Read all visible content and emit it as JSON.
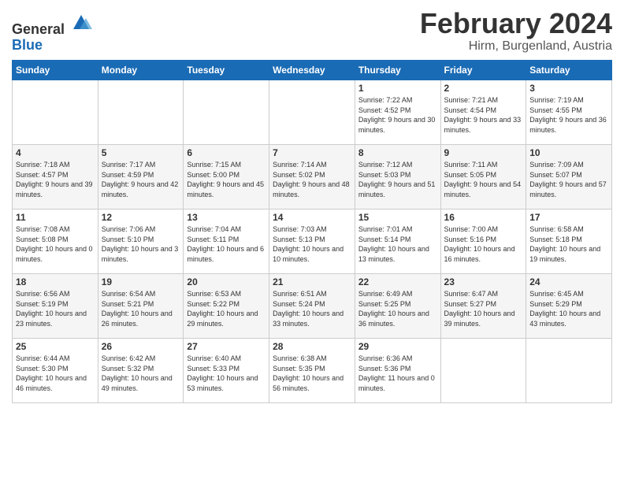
{
  "header": {
    "logo_line1": "General",
    "logo_line2": "Blue",
    "month_title": "February 2024",
    "location": "Hirm, Burgenland, Austria"
  },
  "weekdays": [
    "Sunday",
    "Monday",
    "Tuesday",
    "Wednesday",
    "Thursday",
    "Friday",
    "Saturday"
  ],
  "weeks": [
    [
      {
        "day": "",
        "sunrise": "",
        "sunset": "",
        "daylight": ""
      },
      {
        "day": "",
        "sunrise": "",
        "sunset": "",
        "daylight": ""
      },
      {
        "day": "",
        "sunrise": "",
        "sunset": "",
        "daylight": ""
      },
      {
        "day": "",
        "sunrise": "",
        "sunset": "",
        "daylight": ""
      },
      {
        "day": "1",
        "sunrise": "Sunrise: 7:22 AM",
        "sunset": "Sunset: 4:52 PM",
        "daylight": "Daylight: 9 hours and 30 minutes."
      },
      {
        "day": "2",
        "sunrise": "Sunrise: 7:21 AM",
        "sunset": "Sunset: 4:54 PM",
        "daylight": "Daylight: 9 hours and 33 minutes."
      },
      {
        "day": "3",
        "sunrise": "Sunrise: 7:19 AM",
        "sunset": "Sunset: 4:55 PM",
        "daylight": "Daylight: 9 hours and 36 minutes."
      }
    ],
    [
      {
        "day": "4",
        "sunrise": "Sunrise: 7:18 AM",
        "sunset": "Sunset: 4:57 PM",
        "daylight": "Daylight: 9 hours and 39 minutes."
      },
      {
        "day": "5",
        "sunrise": "Sunrise: 7:17 AM",
        "sunset": "Sunset: 4:59 PM",
        "daylight": "Daylight: 9 hours and 42 minutes."
      },
      {
        "day": "6",
        "sunrise": "Sunrise: 7:15 AM",
        "sunset": "Sunset: 5:00 PM",
        "daylight": "Daylight: 9 hours and 45 minutes."
      },
      {
        "day": "7",
        "sunrise": "Sunrise: 7:14 AM",
        "sunset": "Sunset: 5:02 PM",
        "daylight": "Daylight: 9 hours and 48 minutes."
      },
      {
        "day": "8",
        "sunrise": "Sunrise: 7:12 AM",
        "sunset": "Sunset: 5:03 PM",
        "daylight": "Daylight: 9 hours and 51 minutes."
      },
      {
        "day": "9",
        "sunrise": "Sunrise: 7:11 AM",
        "sunset": "Sunset: 5:05 PM",
        "daylight": "Daylight: 9 hours and 54 minutes."
      },
      {
        "day": "10",
        "sunrise": "Sunrise: 7:09 AM",
        "sunset": "Sunset: 5:07 PM",
        "daylight": "Daylight: 9 hours and 57 minutes."
      }
    ],
    [
      {
        "day": "11",
        "sunrise": "Sunrise: 7:08 AM",
        "sunset": "Sunset: 5:08 PM",
        "daylight": "Daylight: 10 hours and 0 minutes."
      },
      {
        "day": "12",
        "sunrise": "Sunrise: 7:06 AM",
        "sunset": "Sunset: 5:10 PM",
        "daylight": "Daylight: 10 hours and 3 minutes."
      },
      {
        "day": "13",
        "sunrise": "Sunrise: 7:04 AM",
        "sunset": "Sunset: 5:11 PM",
        "daylight": "Daylight: 10 hours and 6 minutes."
      },
      {
        "day": "14",
        "sunrise": "Sunrise: 7:03 AM",
        "sunset": "Sunset: 5:13 PM",
        "daylight": "Daylight: 10 hours and 10 minutes."
      },
      {
        "day": "15",
        "sunrise": "Sunrise: 7:01 AM",
        "sunset": "Sunset: 5:14 PM",
        "daylight": "Daylight: 10 hours and 13 minutes."
      },
      {
        "day": "16",
        "sunrise": "Sunrise: 7:00 AM",
        "sunset": "Sunset: 5:16 PM",
        "daylight": "Daylight: 10 hours and 16 minutes."
      },
      {
        "day": "17",
        "sunrise": "Sunrise: 6:58 AM",
        "sunset": "Sunset: 5:18 PM",
        "daylight": "Daylight: 10 hours and 19 minutes."
      }
    ],
    [
      {
        "day": "18",
        "sunrise": "Sunrise: 6:56 AM",
        "sunset": "Sunset: 5:19 PM",
        "daylight": "Daylight: 10 hours and 23 minutes."
      },
      {
        "day": "19",
        "sunrise": "Sunrise: 6:54 AM",
        "sunset": "Sunset: 5:21 PM",
        "daylight": "Daylight: 10 hours and 26 minutes."
      },
      {
        "day": "20",
        "sunrise": "Sunrise: 6:53 AM",
        "sunset": "Sunset: 5:22 PM",
        "daylight": "Daylight: 10 hours and 29 minutes."
      },
      {
        "day": "21",
        "sunrise": "Sunrise: 6:51 AM",
        "sunset": "Sunset: 5:24 PM",
        "daylight": "Daylight: 10 hours and 33 minutes."
      },
      {
        "day": "22",
        "sunrise": "Sunrise: 6:49 AM",
        "sunset": "Sunset: 5:25 PM",
        "daylight": "Daylight: 10 hours and 36 minutes."
      },
      {
        "day": "23",
        "sunrise": "Sunrise: 6:47 AM",
        "sunset": "Sunset: 5:27 PM",
        "daylight": "Daylight: 10 hours and 39 minutes."
      },
      {
        "day": "24",
        "sunrise": "Sunrise: 6:45 AM",
        "sunset": "Sunset: 5:29 PM",
        "daylight": "Daylight: 10 hours and 43 minutes."
      }
    ],
    [
      {
        "day": "25",
        "sunrise": "Sunrise: 6:44 AM",
        "sunset": "Sunset: 5:30 PM",
        "daylight": "Daylight: 10 hours and 46 minutes."
      },
      {
        "day": "26",
        "sunrise": "Sunrise: 6:42 AM",
        "sunset": "Sunset: 5:32 PM",
        "daylight": "Daylight: 10 hours and 49 minutes."
      },
      {
        "day": "27",
        "sunrise": "Sunrise: 6:40 AM",
        "sunset": "Sunset: 5:33 PM",
        "daylight": "Daylight: 10 hours and 53 minutes."
      },
      {
        "day": "28",
        "sunrise": "Sunrise: 6:38 AM",
        "sunset": "Sunset: 5:35 PM",
        "daylight": "Daylight: 10 hours and 56 minutes."
      },
      {
        "day": "29",
        "sunrise": "Sunrise: 6:36 AM",
        "sunset": "Sunset: 5:36 PM",
        "daylight": "Daylight: 11 hours and 0 minutes."
      },
      {
        "day": "",
        "sunrise": "",
        "sunset": "",
        "daylight": ""
      },
      {
        "day": "",
        "sunrise": "",
        "sunset": "",
        "daylight": ""
      }
    ]
  ]
}
